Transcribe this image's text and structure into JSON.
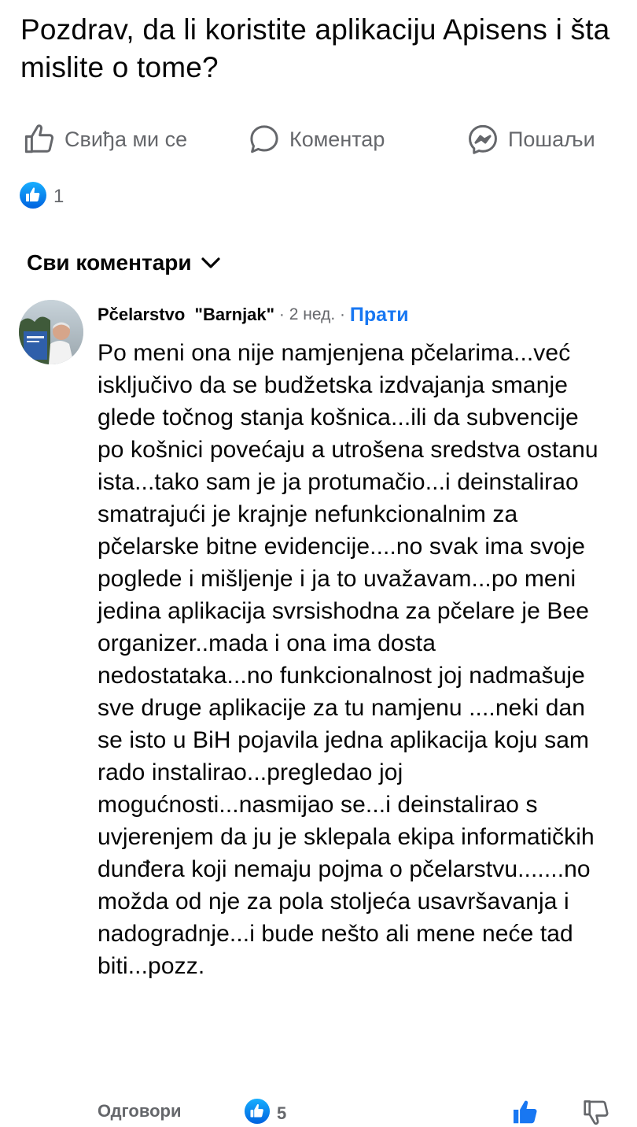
{
  "post": {
    "text": "Pozdrav, da li koristite aplikaciju Apisens i šta mislite o tome?"
  },
  "actions": {
    "like_label": "Свиђа ми се",
    "comment_label": "Коментар",
    "share_label": "Пошаљи"
  },
  "reactions": {
    "count": "1",
    "icon": "like-reaction-icon"
  },
  "comments_filter": {
    "label": "Сви коментари"
  },
  "comment": {
    "author": "Pčelarstvo  \"Barnjak\"",
    "time": " · 2 нед. · ",
    "follow_label": "Прати",
    "text": "Po meni  ona nije namjenjena pčelarima...već isključivo da se budžetska izdvajanja smanje glede točnog stanja košnica...ili da subvencije po košnici povećaju a utrošena sredstva ostanu ista...tako sam je ja protumačio...i deinstalirao smatrajući je krajnje nefunkcionalnim za pčelarske bitne evidencije....no svak ima svoje poglede i mišljenje i ja to uvažavam...po meni jedina aplikacija svrsishodna za pčelare je Bee organizer..mada i ona ima dosta nedostataka...no funkcionalnost joj nadmašuje sve druge aplikacije za tu namjenu ....neki dan se isto u BiH pojavila jedna aplikacija koju sam rado instalirao...pregledao joj mogućnosti...nasmijao se...i deinstalirao s uvjerenjem da ju je sklepala ekipa informatičkih dunđera koji nemaju pojma o pčelarstvu.......no možda od nje za pola stoljeća usavršavanja i nadogradnje...i bude nešto ali mene neće tad biti...pozz.",
    "reply_label": "Одговори",
    "reaction_count": "5"
  },
  "colors": {
    "text": "#050505",
    "secondary": "#65676b",
    "accent": "#1877f2"
  }
}
